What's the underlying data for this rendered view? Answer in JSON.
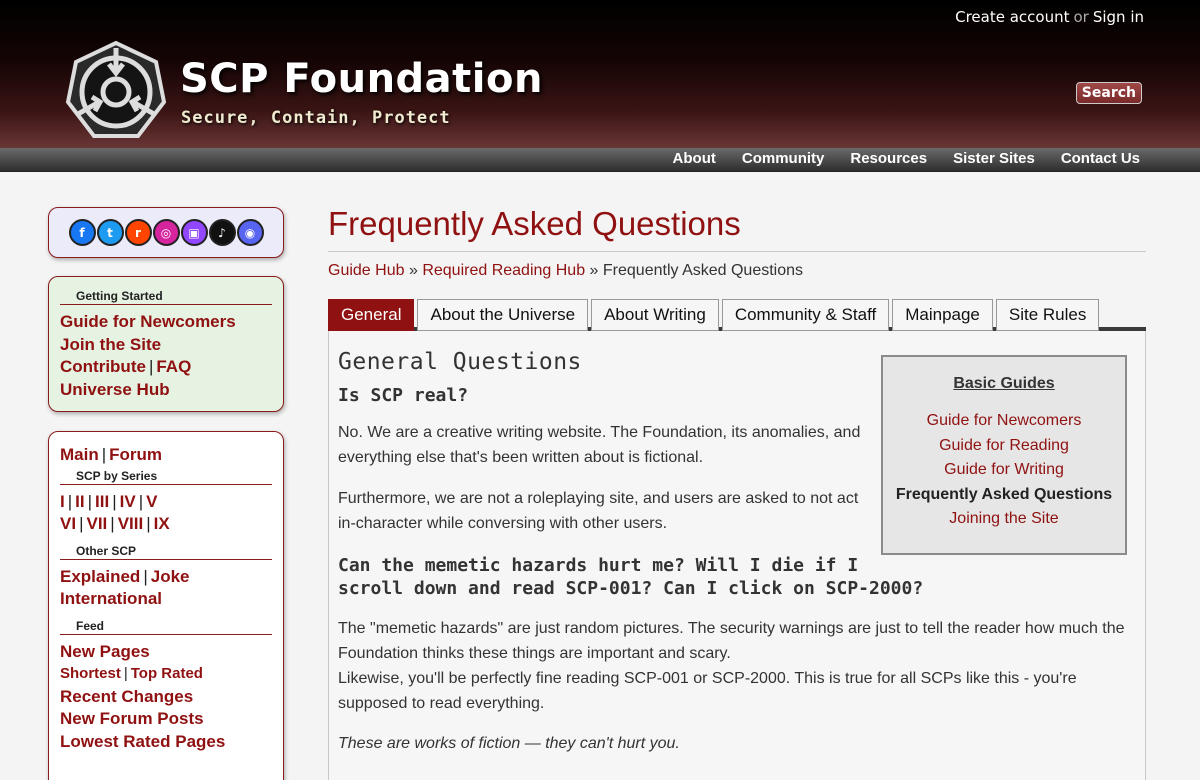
{
  "userbar": {
    "create": "Create account",
    "or": "or",
    "signin": "Sign in"
  },
  "site": {
    "title": "SCP Foundation",
    "subtitle": "Secure, Contain, Protect",
    "search_label": "Search"
  },
  "topnav": [
    "About",
    "Community",
    "Resources",
    "Sister Sites",
    "Contact Us"
  ],
  "social": [
    {
      "icon": "facebook-icon",
      "glyph": "f",
      "color": "#1877f2"
    },
    {
      "icon": "twitter-icon",
      "glyph": "t",
      "color": "#1d9bf0"
    },
    {
      "icon": "reddit-icon",
      "glyph": "r",
      "color": "#ff4500"
    },
    {
      "icon": "instagram-icon",
      "glyph": "◎",
      "color": "#d6249f"
    },
    {
      "icon": "twitch-icon",
      "glyph": "▣",
      "color": "#9146ff"
    },
    {
      "icon": "tiktok-icon",
      "glyph": "♪",
      "color": "#111111"
    },
    {
      "icon": "discord-icon",
      "glyph": "◉",
      "color": "#5865f2"
    }
  ],
  "sidebar": {
    "getting_started": {
      "heading": "Getting Started",
      "newcomers": "Guide for Newcomers",
      "join": "Join the Site",
      "contribute": "Contribute",
      "faq": "FAQ",
      "universe": "Universe Hub"
    },
    "menu": {
      "main": "Main",
      "forum": "Forum",
      "series_heading": "SCP by Series",
      "series_row1": [
        "I",
        "II",
        "III",
        "IV",
        "V"
      ],
      "series_row2": [
        "VI",
        "VII",
        "VIII",
        "IX"
      ],
      "other_heading": "Other SCP",
      "explained": "Explained",
      "joke": "Joke",
      "international": "International",
      "feed_heading": "Feed",
      "new_pages": "New Pages",
      "shortest": "Shortest",
      "top_rated": "Top Rated",
      "recent_changes": "Recent Changes",
      "new_forum_posts": "New Forum Posts",
      "lowest_rated": "Lowest Rated Pages"
    }
  },
  "main": {
    "title": "Frequently Asked Questions",
    "breadcrumb": {
      "hub": "Guide Hub",
      "sep": "»",
      "reading": "Required Reading Hub",
      "current": "Frequently Asked Questions"
    },
    "tabs": [
      "General",
      "About the Universe",
      "About Writing",
      "Community & Staff",
      "Mainpage",
      "Site Rules"
    ],
    "section_title": "General Questions",
    "q1": "Is SCP real?",
    "a1_p1": "No. We are a creative writing website. The Foundation, its anomalies, and everything else that's been written about is fictional.",
    "a1_p2": "Furthermore, we are not a roleplaying site, and users are asked to not act in-character while conversing with other users.",
    "q2_line1": "Can the memetic hazards hurt me? Will I die if I",
    "q2_line2": "scroll down and read SCP-001? Can I click on SCP-2000?",
    "a2_p1": "The \"memetic hazards\" are just random pictures. The security warnings are just to tell the reader how much the Foundation thinks these things are important and scary.",
    "a2_p2": "Likewise, you'll be perfectly fine reading SCP-001 or SCP-2000. This is true for all SCPs like this - you're supposed to read everything.",
    "a2_p3": "These are works of fiction — they can't hurt you."
  },
  "guides": {
    "heading": "Basic Guides",
    "items": [
      "Guide for Newcomers",
      "Guide for Reading",
      "Guide for Writing",
      "Frequently Asked Questions",
      "Joining the Site"
    ]
  }
}
